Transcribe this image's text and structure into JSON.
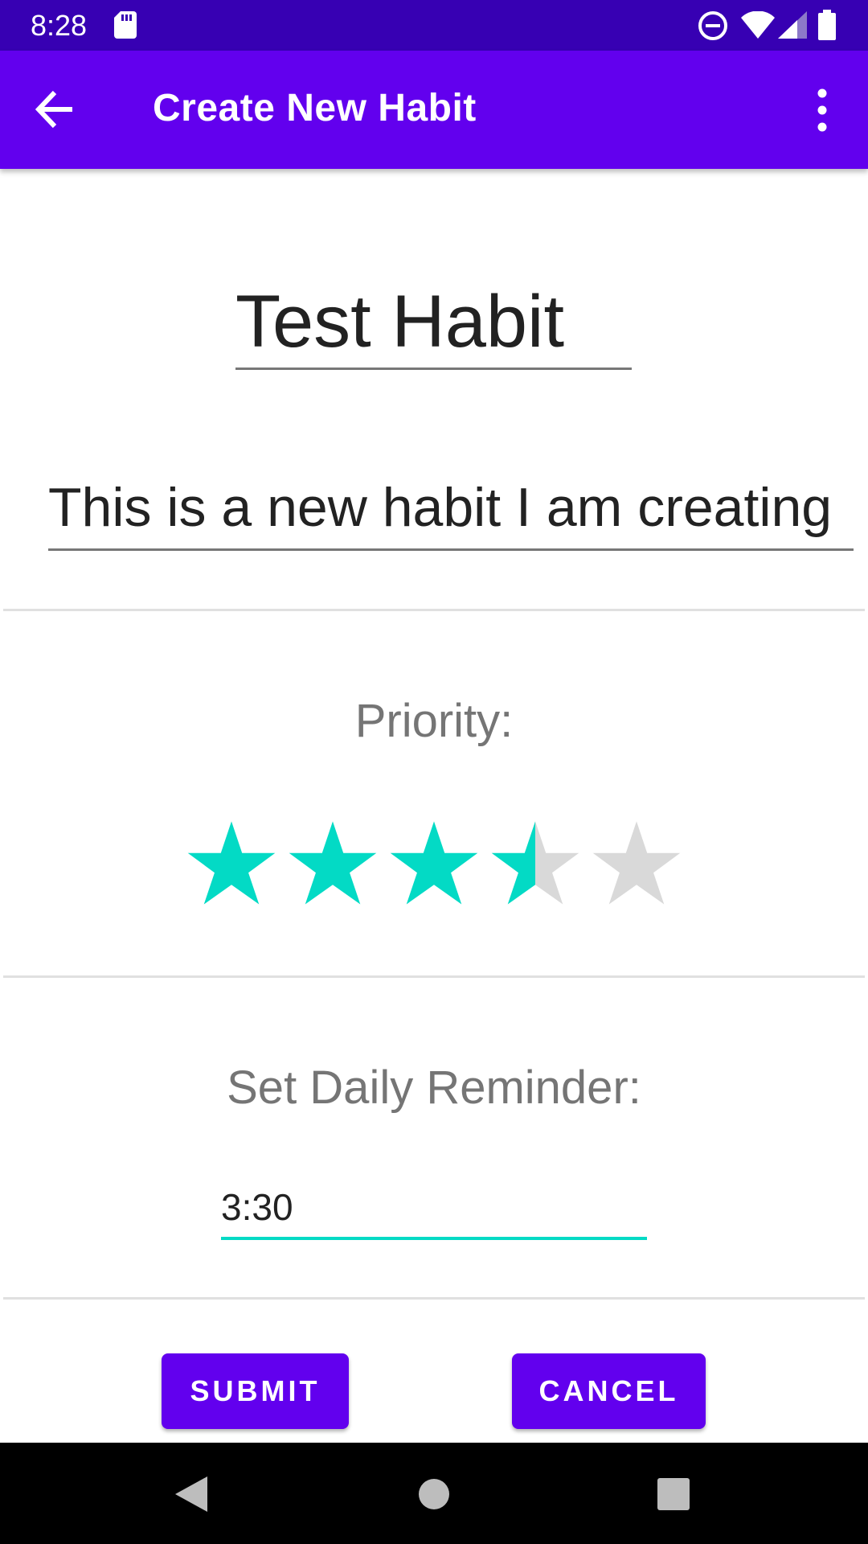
{
  "status_bar": {
    "time": "8:28",
    "icons": [
      "sd-card-icon",
      "do-not-disturb-icon",
      "wifi-icon",
      "cell-signal-icon",
      "battery-icon"
    ]
  },
  "app_bar": {
    "title": "Create New Habit",
    "back_icon": "arrow-back-icon",
    "menu_icon": "more-vert-icon",
    "background": "#6200ee"
  },
  "form": {
    "habit_name": "Test Habit",
    "habit_description": "This is a new habit I am creating",
    "priority_label": "Priority:",
    "priority_rating": 3.5,
    "priority_max": 5,
    "reminder_label": "Set Daily Reminder:",
    "reminder_time": "3:30"
  },
  "actions": {
    "submit_label": "SUBMIT",
    "cancel_label": "CANCEL"
  },
  "colors": {
    "status_bar": "#3700b3",
    "primary": "#6200ee",
    "accent": "#03dac5",
    "star_filled": "#03dac5",
    "star_empty": "#d9d9d9"
  },
  "nav_bar": {
    "icons": [
      "nav-back-icon",
      "nav-home-icon",
      "nav-recents-icon"
    ]
  }
}
